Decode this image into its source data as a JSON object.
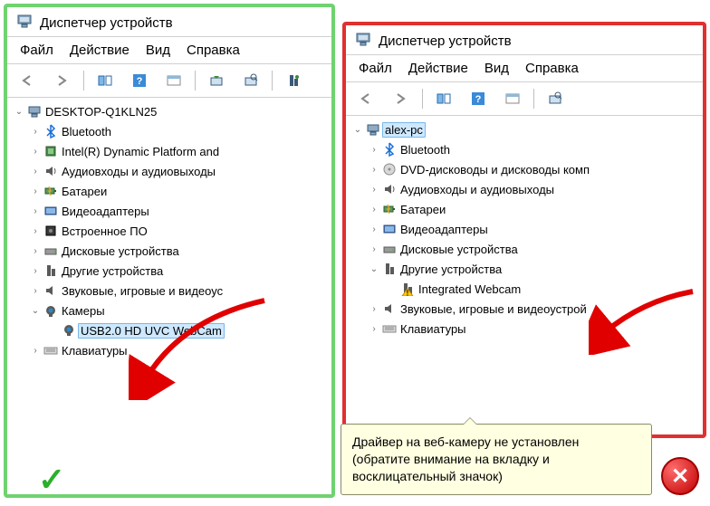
{
  "left": {
    "title": "Диспетчер устройств",
    "menu": {
      "file": "Файл",
      "action": "Действие",
      "view": "Вид",
      "help": "Справка"
    },
    "root": "DESKTOP-Q1KLN25",
    "nodes": {
      "bluetooth": "Bluetooth",
      "intel": "Intel(R) Dynamic Platform and",
      "audio": "Аудиовходы и аудиовыходы",
      "battery": "Батареи",
      "video": "Видеоадаптеры",
      "firmware": "Встроенное ПО",
      "disk": "Дисковые устройства",
      "other": "Другие устройства",
      "sound": "Звуковые, игровые и видеоус",
      "cameras": "Камеры",
      "webcam": "USB2.0 HD UVC WebCam",
      "keyboards": "Клавиатуры"
    }
  },
  "right": {
    "title": "Диспетчер устройств",
    "menu": {
      "file": "Файл",
      "action": "Действие",
      "view": "Вид",
      "help": "Справка"
    },
    "root": "alex-pc",
    "nodes": {
      "bluetooth": "Bluetooth",
      "dvd": "DVD-дисководы и дисководы комп",
      "audio": "Аудиовходы и аудиовыходы",
      "battery": "Батареи",
      "video": "Видеоадаптеры",
      "disk": "Дисковые устройства",
      "other": "Другие устройства",
      "webcam": "Integrated Webcam",
      "sound": "Звуковые, игровые и видеоустрой",
      "keyboards": "Клавиатуры"
    }
  },
  "tooltip": "Драйвер на веб-камеру не установлен (обратите внимание на вкладку и восклицательный значок)"
}
